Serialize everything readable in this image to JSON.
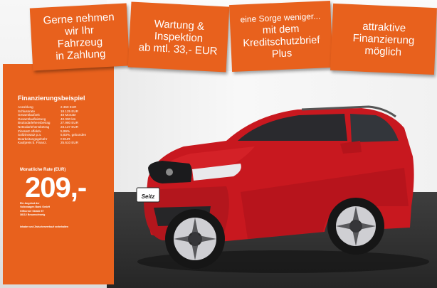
{
  "banners": [
    {
      "lines": [
        "Gerne nehmen",
        "wir Ihr",
        "Fahrzeug",
        "in Zahlung"
      ]
    },
    {
      "lines": [
        "Wartung &",
        "Inspektion",
        "ab mtl. 33,- EUR"
      ]
    },
    {
      "lines": [
        "eine Sorge weniger...",
        "mit dem",
        "Kreditschutzbrief",
        "Plus"
      ]
    },
    {
      "lines": [
        "attraktive",
        "Finanzierung",
        "möglich"
      ]
    }
  ],
  "finance": {
    "title": "Finanzierungsbeispiel",
    "rows": [
      {
        "label": "Anzahlung",
        "value": "2.360 EUR"
      },
      {
        "label": "Schlussrate",
        "value": "18.125 EUR"
      },
      {
        "label": "Gesamtlaufzeit",
        "value": "48 Monate"
      },
      {
        "label": "Gesamtlaufleistung",
        "value": "40.000 km"
      },
      {
        "label": "Bruttodarlehensbetrag",
        "value": "27.980 EUR"
      },
      {
        "label": "Nettodarlehensbetrag",
        "value": "23.127 EUR"
      },
      {
        "label": "Zinssatz effektiv",
        "value": "5,99%"
      },
      {
        "label": "Sollzinssatz p.a.",
        "value": "5,83%, gebunden"
      },
      {
        "label": "Bearbeitungsgebühr",
        "value": "0 EUR"
      },
      {
        "label": "Kaufpreis b. Finanz.",
        "value": "25.610 EUR"
      }
    ],
    "rate_label": "Monatliche Rate (EUR)",
    "rate_value": "209,-",
    "lender_lines": [
      "Ein Angebot der",
      "Volkswagen Bank GmbH",
      "Gifhorner Straße 57",
      "38112 Braunschweig"
    ],
    "footnote": "Inhaber und Zwischenverkauf vorbehalten"
  },
  "car": {
    "plate_text": "Seitz",
    "colors": {
      "body": "#c8181f",
      "body_dark": "#8e0f15",
      "accent": "#e8611d"
    }
  }
}
